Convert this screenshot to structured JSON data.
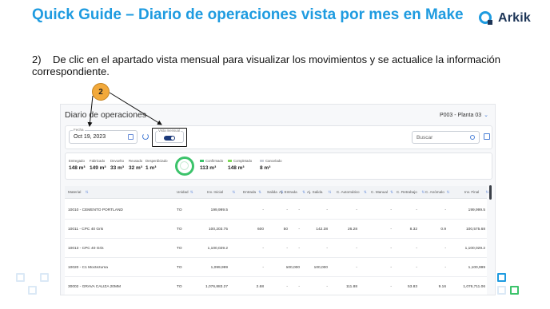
{
  "slide": {
    "title": "Quick Guide – Diario de operaciones vista por mes en Make",
    "logo_text": "Arkik",
    "step_number": "2)",
    "instruction": "De clic en el apartado vista mensual para visualizar los movimientos y se actualice la información correspondiente.",
    "badge": "2"
  },
  "app": {
    "title": "Diario de operaciones",
    "plant": "P003 - Planta 03",
    "date_label": "Fecha",
    "date_value": "Oct 19, 2023",
    "toggle_label": "Vista mensual",
    "search_placeholder": "Buscar"
  },
  "stats": [
    {
      "label": "Entregado",
      "value": "148 m³"
    },
    {
      "label": "Fabricado",
      "value": "149 m³"
    },
    {
      "label": "Devuelto",
      "value": "33 m³"
    },
    {
      "label": "Reusado",
      "value": "32 m³"
    },
    {
      "label": "Desperdiciado",
      "value": "1 m³"
    }
  ],
  "status_stats": [
    {
      "label": "Confirmado",
      "value": "113 m³",
      "color": "#3cc36b"
    },
    {
      "label": "Completado",
      "value": "148 m³",
      "color": "#7ed957"
    },
    {
      "label": "Cancelado",
      "value": "8 m³",
      "color": "#c9ced6"
    }
  ],
  "table": {
    "headers": [
      "Material",
      "Unidad",
      "Inv. Inicial",
      "Entrada",
      "Salida",
      "Aj. Entrada",
      "Aj. Salida",
      "C. Automático",
      "C. Manual",
      "C. Retrabajo",
      "C. Anómalo",
      "Inv. Final"
    ],
    "rows": [
      [
        "10010 - CEMENTO PORTLAND",
        "TO",
        "199,999.5",
        "-",
        "-",
        "-",
        "-",
        "-",
        "-",
        "-",
        "-",
        "199,999.5"
      ],
      [
        "10011 - CPC 40 Gris",
        "TO",
        "100,203.75",
        "600",
        "50",
        "-",
        "142.38",
        "26.28",
        "-",
        "8.32",
        "0.9",
        "100,575.68"
      ],
      [
        "10013 - CPC 40 Gris",
        "TO",
        "1,100,029.2",
        "-",
        "-",
        "-",
        "-",
        "-",
        "-",
        "-",
        "-",
        "1,100,029.2"
      ],
      [
        "10020 - C1 Moctezuma",
        "TO",
        "1,099,999",
        "-",
        "-",
        "100,000",
        "100,000",
        "-",
        "-",
        "-",
        "-",
        "1,100,999"
      ],
      [
        "30002 - GRAVA CALIZA 20MM",
        "TO",
        "1,076,883.27",
        "2.68",
        "-",
        "-",
        "-",
        "111.88",
        "-",
        "53.83",
        "9.16",
        "1,076,711.06"
      ]
    ]
  },
  "colors": {
    "title_blue": "#1e9be0",
    "badge_orange": "#f2a93b",
    "accent_green": "#3cc36b",
    "toggle_navy": "#1d3a7a"
  }
}
